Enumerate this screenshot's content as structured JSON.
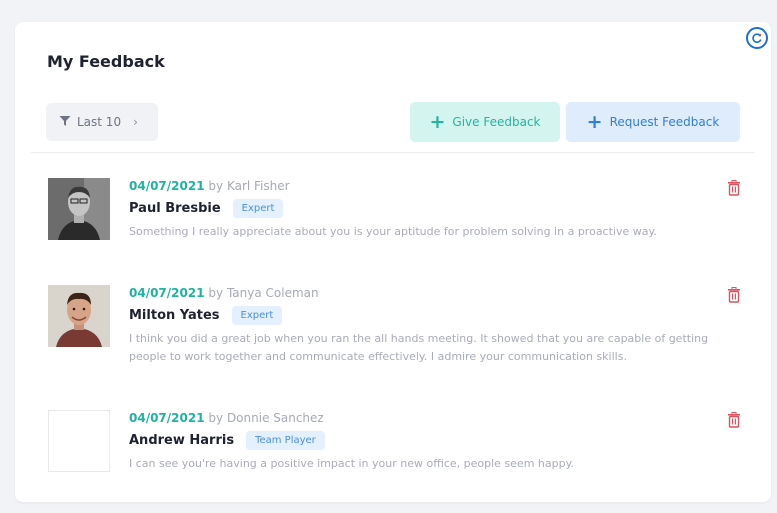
{
  "panel": {
    "title": "My Feedback",
    "filter_label": "Last 10",
    "give_label": "Give Feedback",
    "request_label": "Request Feedback"
  },
  "feedback": [
    {
      "date": "04/07/2021",
      "by_prefix": "by",
      "author": "Karl Fisher",
      "recipient": "Paul Bresbie",
      "tag": "Expert",
      "text": "Something I really appreciate about you is your aptitude for problem solving in a proactive way."
    },
    {
      "date": "04/07/2021",
      "by_prefix": "by",
      "author": "Tanya Coleman",
      "recipient": "Milton Yates",
      "tag": "Expert",
      "text": "I think you did a great job when you ran the all hands meeting. It showed that you are capable of getting people to work together and communicate effectively. I admire your communication skills."
    },
    {
      "date": "04/07/2021",
      "by_prefix": "by",
      "author": "Donnie Sanchez",
      "recipient": "Andrew Harris",
      "tag": "Team Player",
      "text": "I can see you're having a positive impact in your new office, people seem happy."
    }
  ],
  "icons": {
    "refresh": "refresh-icon",
    "filter": "filter-icon",
    "chevron": "chevron-right-icon",
    "plus": "plus-icon",
    "delete": "trash-icon"
  },
  "colors": {
    "accent_teal": "#20b3a0",
    "accent_blue": "#2f7fdb",
    "delete_red": "#e0505e"
  }
}
